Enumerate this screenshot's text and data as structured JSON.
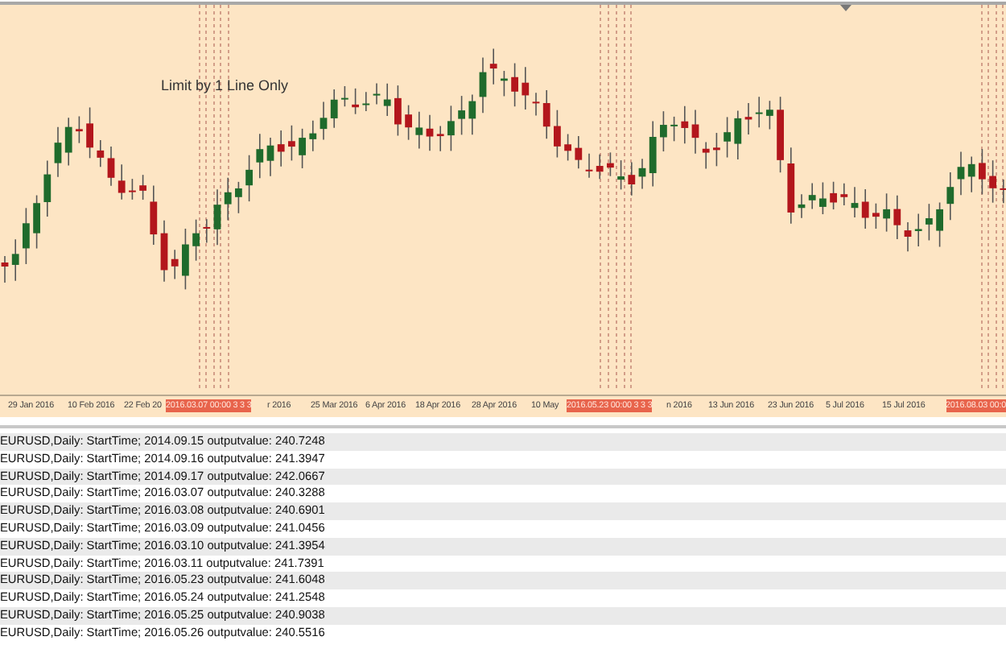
{
  "chart": {
    "annotation": "Limit by 1 Line Only",
    "axis_labels": [
      {
        "kind": "date",
        "text": "29 Jan 2016"
      },
      {
        "kind": "date",
        "text": "10 Feb 2016"
      },
      {
        "kind": "date",
        "text": "22 Feb 20"
      },
      {
        "kind": "marker",
        "text": "2016.03.07 00:00 3 3 3"
      },
      {
        "kind": "date",
        "text": "r 2016"
      },
      {
        "kind": "date",
        "text": "25 Mar 2016"
      },
      {
        "kind": "date",
        "text": "6 Apr 2016"
      },
      {
        "kind": "date",
        "text": "18 Apr 2016"
      },
      {
        "kind": "date",
        "text": "28 Apr 2016"
      },
      {
        "kind": "date",
        "text": "10 May"
      },
      {
        "kind": "marker",
        "text": "2016.05.23 00:00 3 3 3"
      },
      {
        "kind": "date",
        "text": "n 2016"
      },
      {
        "kind": "date",
        "text": "13 Jun 2016"
      },
      {
        "kind": "date",
        "text": "23 Jun 2016"
      },
      {
        "kind": "date",
        "text": "5 Jul 2016"
      },
      {
        "kind": "date",
        "text": "15 Jul 2016"
      },
      {
        "kind": "marker",
        "text": "2016.08.03 00:0"
      }
    ]
  },
  "output_rows": [
    "EURUSD,Daily: StartTime; 2014.09.15 outputvalue: 240.7248",
    "EURUSD,Daily: StartTime; 2014.09.16 outputvalue: 241.3947",
    "EURUSD,Daily: StartTime; 2014.09.17 outputvalue: 242.0667",
    "EURUSD,Daily: StartTime; 2016.03.07 outputvalue: 240.3288",
    "EURUSD,Daily: StartTime; 2016.03.08 outputvalue: 240.6901",
    "EURUSD,Daily: StartTime; 2016.03.09 outputvalue: 241.0456",
    "EURUSD,Daily: StartTime; 2016.03.10 outputvalue: 241.3954",
    "EURUSD,Daily: StartTime; 2016.03.11 outputvalue: 241.7391",
    "EURUSD,Daily: StartTime; 2016.05.23 outputvalue: 241.6048",
    "EURUSD,Daily: StartTime; 2016.05.24 outputvalue: 241.2548",
    "EURUSD,Daily: StartTime; 2016.05.25 outputvalue: 240.9038",
    "EURUSD,Daily: StartTime; 2016.05.26 outputvalue: 240.5516"
  ]
}
